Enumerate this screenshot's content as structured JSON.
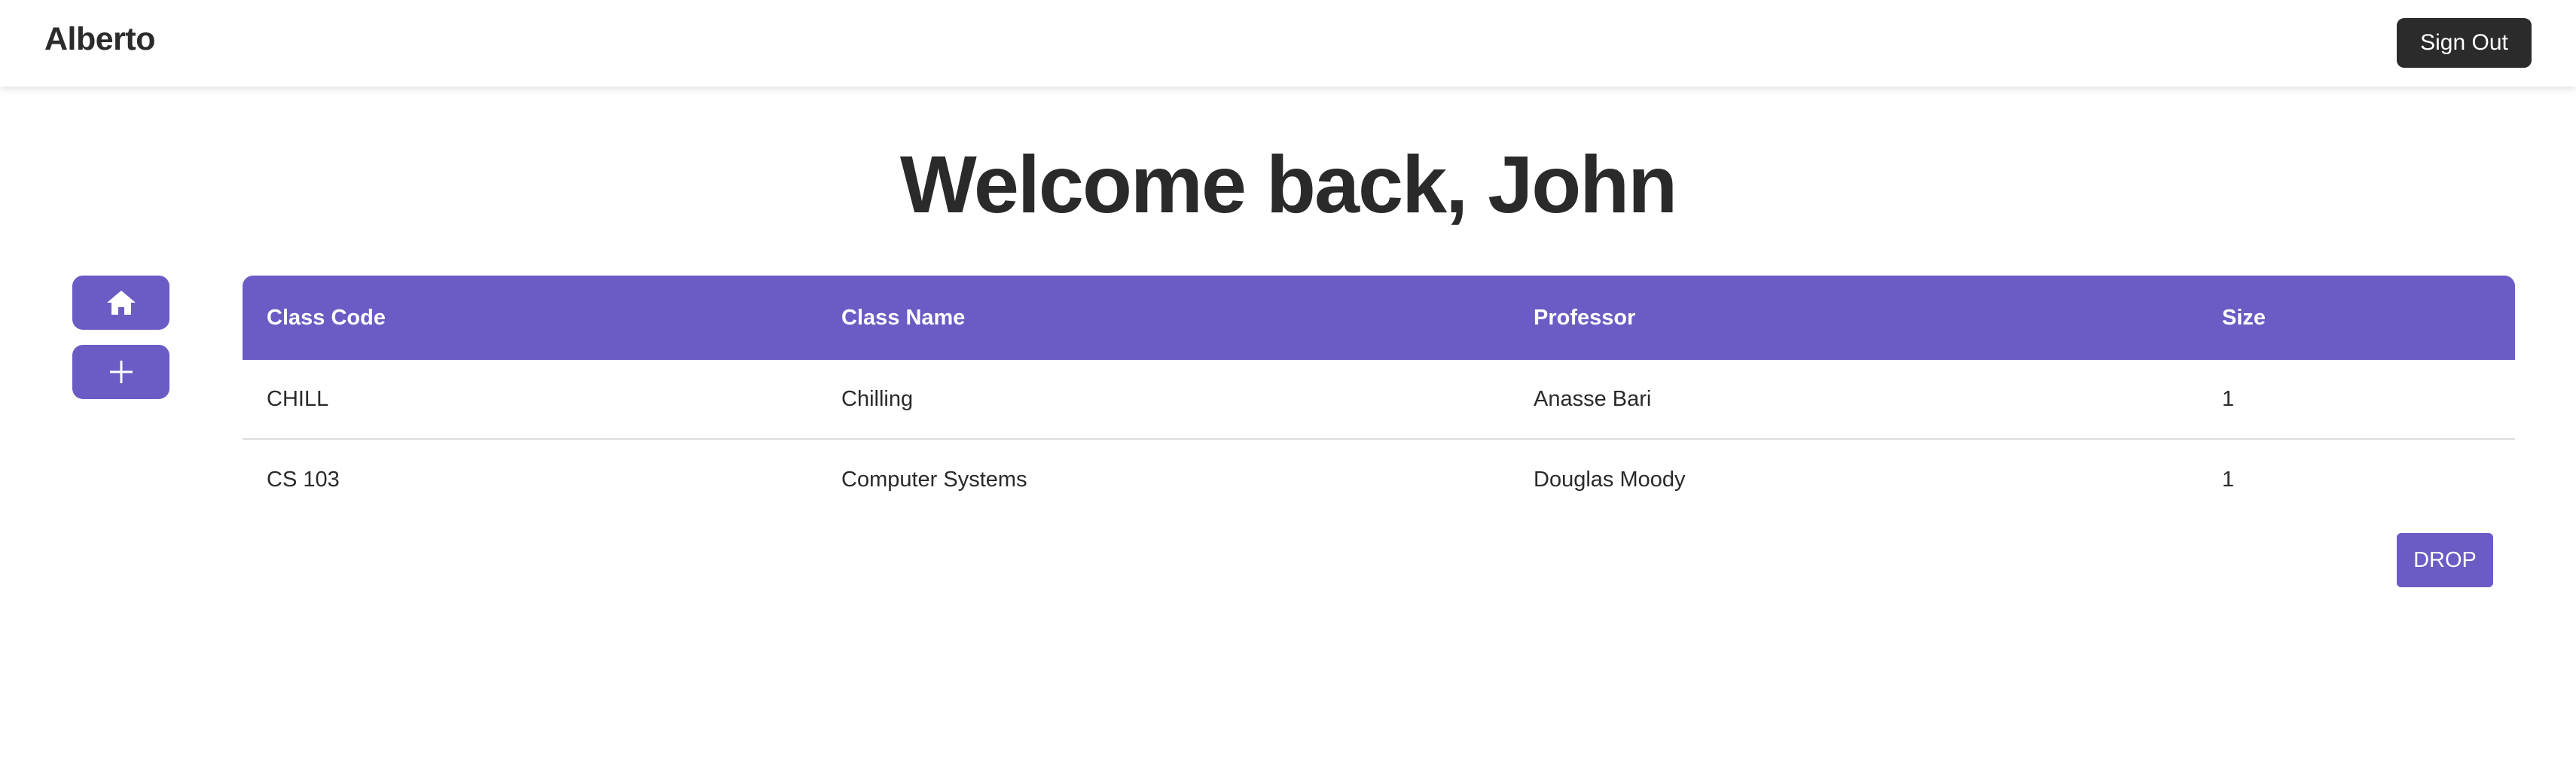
{
  "navbar": {
    "brand": "Alberto",
    "sign_out_label": "Sign Out"
  },
  "main": {
    "welcome": "Welcome back, John"
  },
  "sidebar": {
    "buttons": [
      {
        "icon": "home-icon"
      },
      {
        "icon": "plus-icon"
      }
    ]
  },
  "table": {
    "headers": [
      "Class Code",
      "Class Name",
      "Professor",
      "Size"
    ],
    "rows": [
      [
        "CHILL",
        "Chilling",
        "Anasse Bari",
        "1"
      ],
      [
        "CS 103",
        "Computer Systems",
        "Douglas Moody",
        "1"
      ]
    ],
    "drop_label": "DROP"
  },
  "colors": {
    "accent": "#6a5cc4",
    "dark_button": "#2b2b2b",
    "text": "#2a2a2a",
    "divider": "#dcdcdc"
  }
}
